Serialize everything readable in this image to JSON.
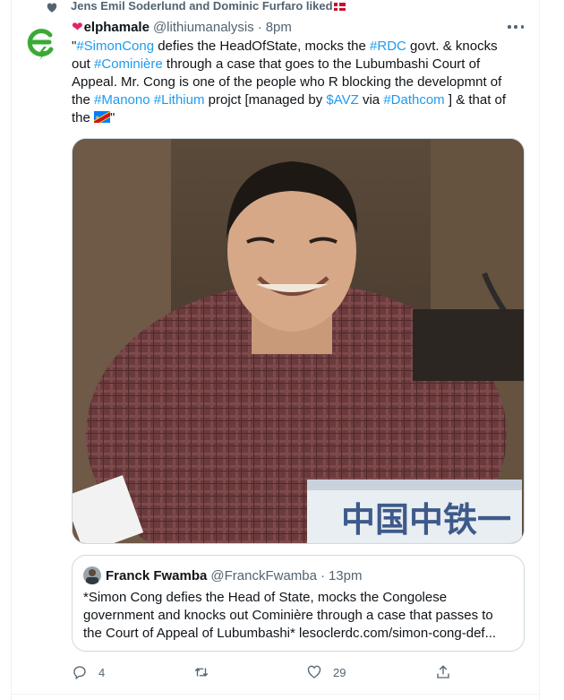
{
  "social_context": {
    "text": "Jens Emil Soderlund  and Dominic Furfaro liked"
  },
  "tweet": {
    "display_name": "elphamale",
    "handle": "@lithiumanalysis",
    "separator": "·",
    "time": "8pm",
    "lines": [
      [
        {
          "t": "\"",
          "c": 0
        },
        {
          "t": "#SimonCong",
          "c": 1
        },
        {
          "t": " defies the HeadOfState, mocks the ",
          "c": 0
        },
        {
          "t": "#RDC",
          "c": 1
        },
        {
          "t": " govt. & knocks",
          "c": 0
        }
      ],
      [
        {
          "t": "out ",
          "c": 0
        },
        {
          "t": "#Cominière",
          "c": 1
        },
        {
          "t": " through a case that goes to the Lubumbashi Court of",
          "c": 0
        }
      ],
      [
        {
          "t": "Appeal. Mr. Cong is one of the people who R blocking the developmnt of",
          "c": 0
        }
      ],
      [
        {
          "t": "the ",
          "c": 0
        },
        {
          "t": "#Manono",
          "c": 1
        },
        {
          "t": " ",
          "c": 0
        },
        {
          "t": "#Lithium",
          "c": 1
        },
        {
          "t": " projct [managed by ",
          "c": 0
        },
        {
          "t": "$AVZ",
          "c": 1
        },
        {
          "t": " via ",
          "c": 0
        },
        {
          "t": "#Dathcom",
          "c": 1
        },
        {
          "t": " ] & that of",
          "c": 0
        }
      ],
      [
        {
          "t": "the ",
          "c": 0
        },
        {
          "t": "[flag]",
          "c": 2
        },
        {
          "t": "\"",
          "c": 0
        }
      ]
    ],
    "photo_sign_text": "中国中铁一"
  },
  "quote": {
    "display_name": "Franck Fwamba",
    "handle": "@FranckFwamba",
    "separator": "·",
    "time": "13pm",
    "lines": [
      "*Simon Cong defies the Head of State, mocks the Congolese",
      "government and knocks out Cominière through a case that passes to",
      "the Court of Appeal of Lubumbashi*  lesoclerdc.com/simon-cong-def..."
    ]
  },
  "actions": {
    "replies": "4",
    "retweets": "",
    "likes": "29"
  },
  "colors": {
    "link": "#1d9bf0",
    "secondary": "#536471",
    "heart_red": "#e0245e",
    "avatar_green": "#3aaa35"
  }
}
